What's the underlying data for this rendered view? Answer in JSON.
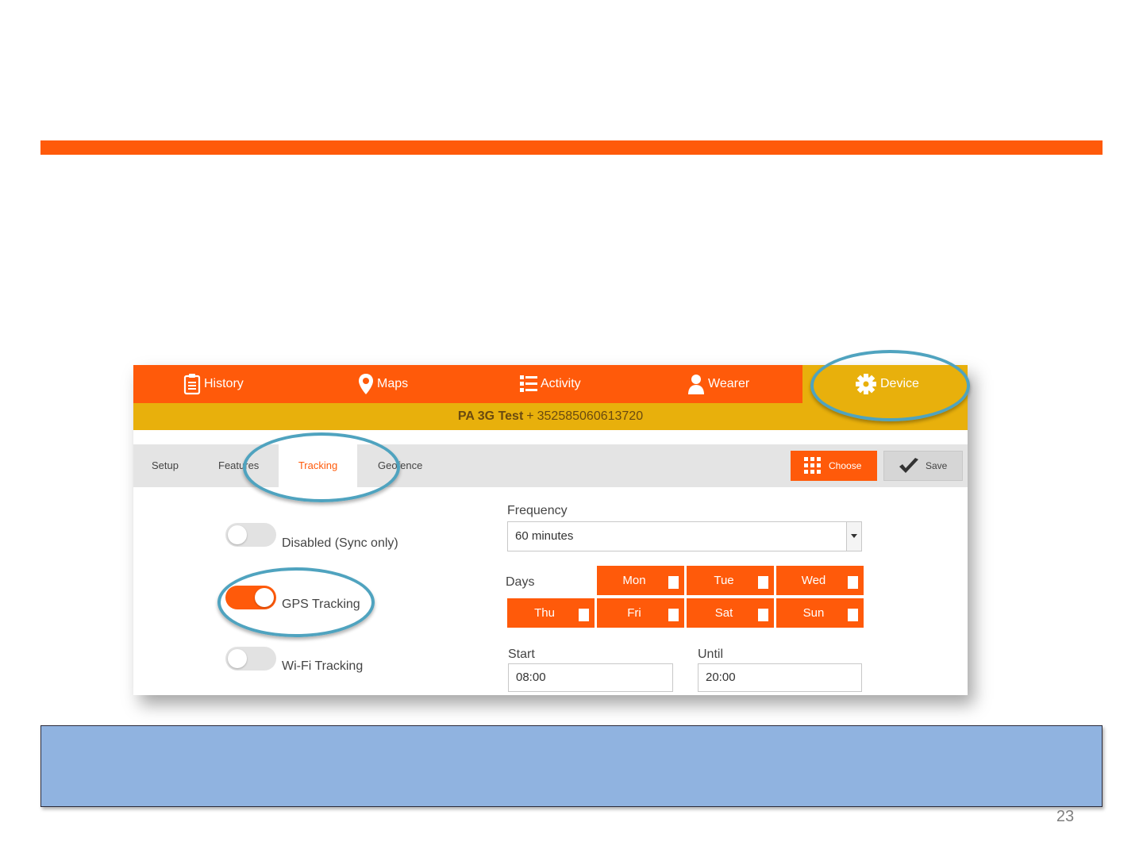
{
  "colors": {
    "accent": "#ff5a0a",
    "subbar": "#e8b00c",
    "ring": "#4fa3bf",
    "caption": "#90b3e0"
  },
  "nav": {
    "history": {
      "label": "History",
      "icon": "clipboard-icon"
    },
    "maps": {
      "label": "Maps",
      "icon": "map-pin-icon"
    },
    "activity": {
      "label": "Activity",
      "icon": "list-icon"
    },
    "wearer": {
      "label": "Wearer",
      "icon": "person-icon"
    },
    "device": {
      "label": "Device",
      "icon": "gear-icon"
    }
  },
  "device_bar": {
    "name": "PA 3G Test",
    "separator": "+",
    "id": "352585060613720"
  },
  "tabs": {
    "setup": "Setup",
    "features": "Features",
    "tracking": "Tracking",
    "geofence": "Geofence"
  },
  "buttons": {
    "choose": "Choose",
    "save": "Save"
  },
  "toggles": {
    "disabled": {
      "label": "Disabled (Sync only)",
      "on": false
    },
    "gps": {
      "label": "GPS Tracking",
      "on": true
    },
    "wifi": {
      "label": "Wi-Fi Tracking",
      "on": false
    }
  },
  "frequency": {
    "label": "Frequency",
    "value": "60 minutes"
  },
  "days": {
    "label": "Days",
    "mon": "Mon",
    "tue": "Tue",
    "wed": "Wed",
    "thu": "Thu",
    "fri": "Fri",
    "sat": "Sat",
    "sun": "Sun"
  },
  "schedule": {
    "start_label": "Start",
    "start_value": "08:00",
    "until_label": "Until",
    "until_value": "20:00"
  },
  "page_number": "23"
}
